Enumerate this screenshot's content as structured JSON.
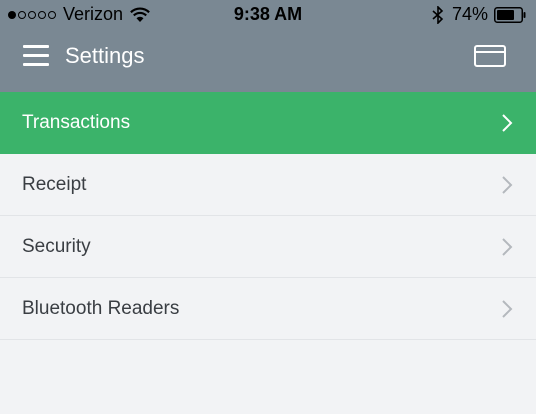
{
  "status_bar": {
    "carrier": "Verizon",
    "time": "9:38 AM",
    "battery": "74%",
    "signal_bars": 1,
    "signal_total": 5
  },
  "header": {
    "title": "Settings",
    "menu_icon": "hamburger-icon",
    "right_icon": "card-icon"
  },
  "menu": {
    "items": [
      {
        "label": "Transactions",
        "active": true
      },
      {
        "label": "Receipt",
        "active": false
      },
      {
        "label": "Security",
        "active": false
      },
      {
        "label": "Bluetooth Readers",
        "active": false
      }
    ]
  },
  "colors": {
    "header_bg": "#7a8893",
    "active_bg": "#3bb36a",
    "page_bg": "#f2f3f5"
  }
}
